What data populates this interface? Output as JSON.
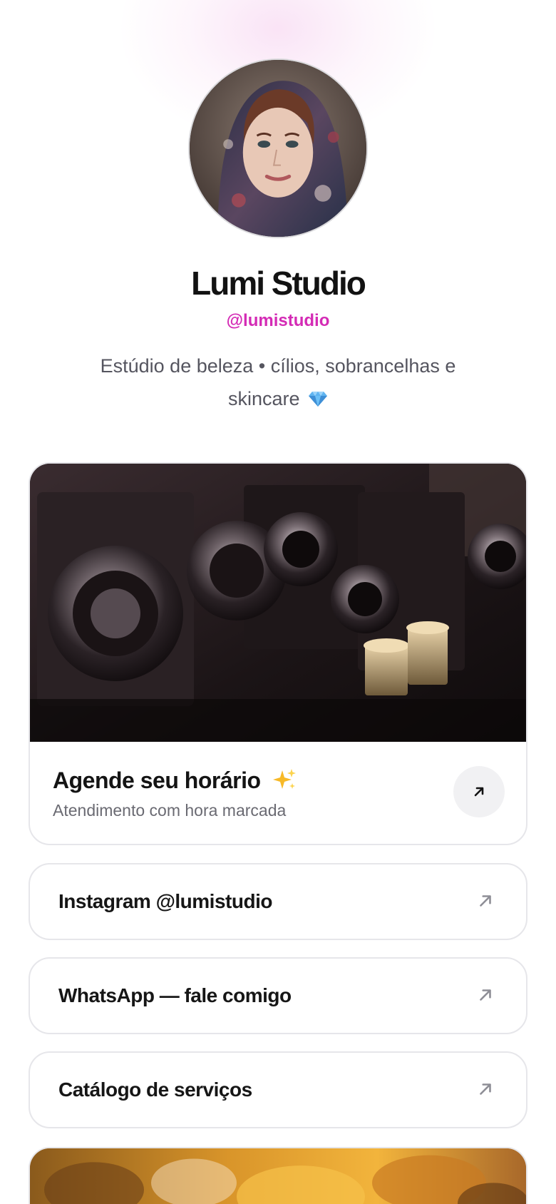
{
  "profile": {
    "name": "Lumi Studio",
    "handle": "@lumistudio",
    "bio": "Estúdio de beleza • cílios, sobrancelhas e skincare",
    "avatar_icon": "profile-photo",
    "bio_icon": "gem-icon"
  },
  "featured": {
    "title": "Agende seu horário",
    "title_icon": "sparkles-icon",
    "subtitle": "Atendimento com hora marcada",
    "image_icon": "vintage-cameras-photo",
    "arrow_icon": "arrow-up-right-icon"
  },
  "links": [
    {
      "label": "Instagram @lumistudio",
      "icon": "arrow-up-right-icon"
    },
    {
      "label": "WhatsApp — fale comigo",
      "icon": "arrow-up-right-icon"
    },
    {
      "label": "Catálogo de serviços",
      "icon": "arrow-up-right-icon"
    }
  ],
  "bottom_card": {
    "image_icon": "autumn-leaves-photo"
  },
  "colors": {
    "accent": "#d42bb5",
    "text": "#121212",
    "muted": "#55555f",
    "border": "#e6e6ea",
    "arrow_bg": "#f1f1f3"
  }
}
